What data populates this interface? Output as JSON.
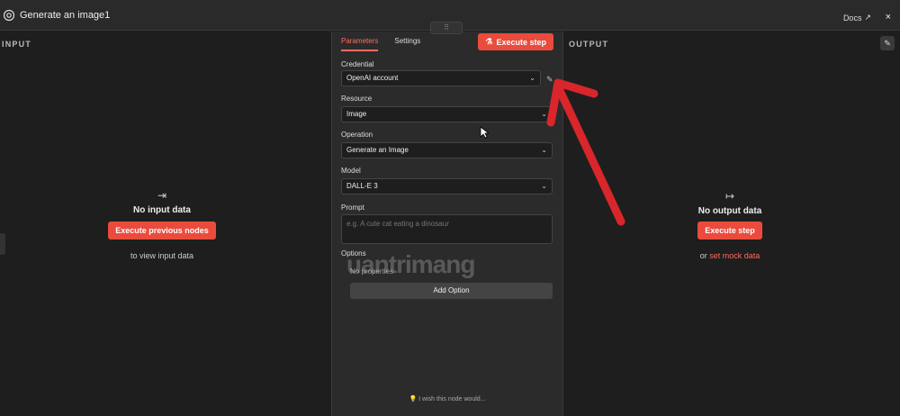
{
  "window": {
    "title": "Generate an image1",
    "docs_label": "Docs",
    "close_label": "×"
  },
  "input_panel": {
    "label": "INPUT",
    "empty_title": "No input data",
    "execute_button": "Execute previous nodes",
    "hint": "to view input data"
  },
  "output_panel": {
    "label": "OUTPUT",
    "empty_title": "No output data",
    "execute_button": "Execute step",
    "hint_prefix": "or",
    "mock_link": "set mock data"
  },
  "parameters": {
    "tabs": [
      "Parameters",
      "Settings"
    ],
    "execute_button": "Execute step",
    "credential": {
      "label": "Credential",
      "value": "OpenAI account"
    },
    "resource": {
      "label": "Resource",
      "value": "Image"
    },
    "operation": {
      "label": "Operation",
      "value": "Generate an Image"
    },
    "model": {
      "label": "Model",
      "value": "DALL-E 3"
    },
    "prompt": {
      "label": "Prompt",
      "placeholder": "e.g. A cute cat eating a dinosaur"
    },
    "options": {
      "label": "Options",
      "empty": "No properties",
      "add_button": "Add Option"
    },
    "feedback": "I wish this node would..."
  },
  "watermark": "uantrimang",
  "colors": {
    "accent": "#ea4b3c",
    "arrow": "#d8262b"
  }
}
